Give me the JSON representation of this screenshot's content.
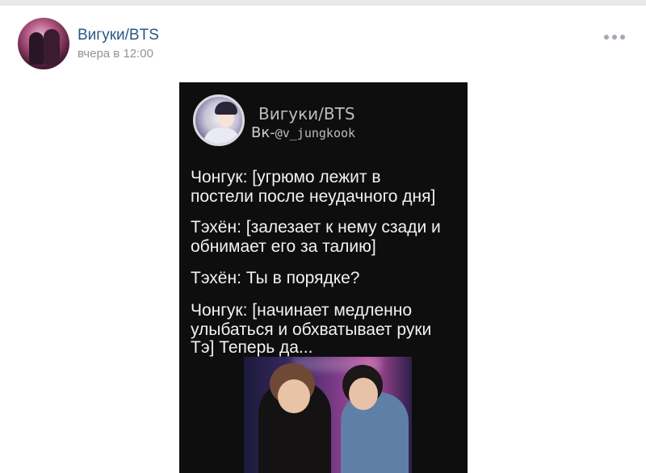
{
  "post": {
    "author": "Вигуки/BTS",
    "date": "вчера в 12:00"
  },
  "image_card": {
    "title": "Вигуки/BTS",
    "handle_prefix": "Вк-",
    "handle": "@v_jungkook",
    "lines": [
      "Чонгук: [угрюмо лежит в",
      "постели после неудачного дня]",
      "Тэхён: [залезает к нему сзади и",
      "обнимает его за талию]",
      "Тэхён: Ты в порядке?",
      "Чонгук: [начинает медленно",
      "улыбаться и обхватывает руки",
      "Тэ] Теперь да..."
    ]
  },
  "icons": {
    "more": "more-horizontal-icon"
  },
  "colors": {
    "author_link": "#2a5885",
    "date": "#939393",
    "image_bg": "#0e0e0e"
  }
}
